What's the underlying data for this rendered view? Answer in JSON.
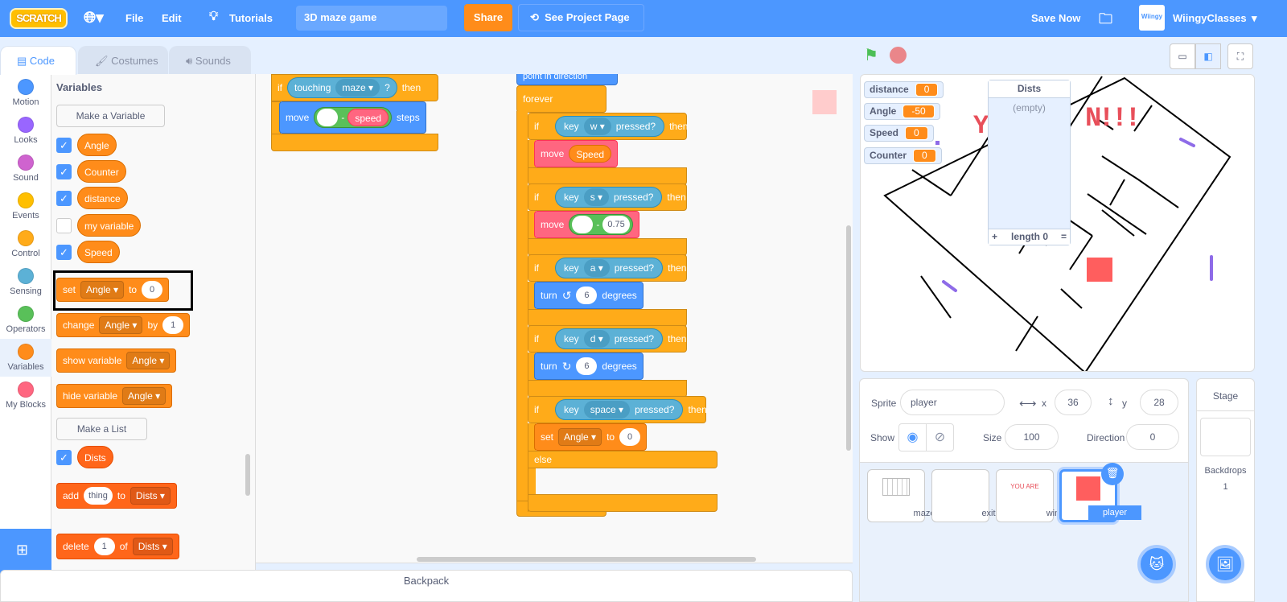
{
  "topbar": {
    "logo": "SCRATCH",
    "file": "File",
    "edit": "Edit",
    "tutorials": "Tutorials",
    "project_title": "3D maze game",
    "share": "Share",
    "see_project_page": "See Project Page",
    "save_now": "Save Now",
    "username": "WiingyClasses"
  },
  "tabs": [
    {
      "label": "Code"
    },
    {
      "label": "Costumes"
    },
    {
      "label": "Sounds"
    }
  ],
  "categories": [
    {
      "label": "Motion",
      "color": "#4c97ff"
    },
    {
      "label": "Looks",
      "color": "#9966ff"
    },
    {
      "label": "Sound",
      "color": "#cf63cf"
    },
    {
      "label": "Events",
      "color": "#ffbf00"
    },
    {
      "label": "Control",
      "color": "#ffab19"
    },
    {
      "label": "Sensing",
      "color": "#5cb1d6"
    },
    {
      "label": "Operators",
      "color": "#59c059"
    },
    {
      "label": "Variables",
      "color": "#ff8c1a"
    },
    {
      "label": "My Blocks",
      "color": "#ff6680"
    }
  ],
  "palette": {
    "heading": "Variables",
    "make_variable": "Make a Variable",
    "make_list": "Make a List",
    "variables": [
      {
        "name": "Angle",
        "checked": true
      },
      {
        "name": "Counter",
        "checked": true
      },
      {
        "name": "distance",
        "checked": true
      },
      {
        "name": "my variable",
        "checked": false
      },
      {
        "name": "Speed",
        "checked": true
      }
    ],
    "set": {
      "kw": "set",
      "var": "Angle",
      "to": "to",
      "val": "0"
    },
    "change": {
      "kw": "change",
      "var": "Angle",
      "by": "by",
      "val": "1"
    },
    "show": {
      "kw": "show variable",
      "var": "Angle"
    },
    "hide": {
      "kw": "hide variable",
      "var": "Angle"
    },
    "list": {
      "name": "Dists",
      "checked": true
    },
    "add": {
      "kw": "add",
      "val": "thing",
      "to": "to",
      "list": "Dists"
    },
    "delete": {
      "kw": "delete",
      "val": "1",
      "of": "of",
      "list": "Dists"
    }
  },
  "script1": {
    "if": "if",
    "touching": "touching",
    "maze": "maze",
    "q": "?",
    "then": "then",
    "move": "move",
    "minus": "-",
    "speed": "speed",
    "steps": "steps"
  },
  "script2": {
    "point": "point in direction",
    "forever": "forever",
    "if": "if",
    "then": "then",
    "key": "key",
    "pressed": "pressed?",
    "w": "w",
    "s": "s",
    "a": "a",
    "d": "d",
    "space": "space",
    "move": "move",
    "Speed": "Speed",
    "minus": "-",
    "val075": "0.75",
    "turn": "turn",
    "six": "6",
    "degrees": "degrees",
    "set": "set",
    "angle": "Angle",
    "to": "to",
    "zero": "0",
    "else": "else"
  },
  "backpack": "Backpack",
  "monitors": [
    {
      "name": "distance",
      "value": "0"
    },
    {
      "name": "Angle",
      "value": "-50"
    },
    {
      "name": "Speed",
      "value": "0"
    },
    {
      "name": "Counter",
      "value": "0"
    }
  ],
  "list_monitor": {
    "title": "Dists",
    "empty": "(empty)",
    "add": "+",
    "length": "length 0",
    "resize": "="
  },
  "stage_text": "N!!!",
  "sprite_info": {
    "sprite_label": "Sprite",
    "sprite_name": "player",
    "x_label": "x",
    "x": "36",
    "y_label": "y",
    "y": "28",
    "show_label": "Show",
    "size_label": "Size",
    "size": "100",
    "direction_label": "Direction",
    "direction": "0"
  },
  "sprites": [
    {
      "name": "maze"
    },
    {
      "name": "exit"
    },
    {
      "name": "win",
      "thumb_text": "YOU ARE"
    },
    {
      "name": "player",
      "selected": true
    }
  ],
  "stage_pane": {
    "title": "Stage",
    "backdrops_label": "Backdrops",
    "backdrops": "1"
  }
}
